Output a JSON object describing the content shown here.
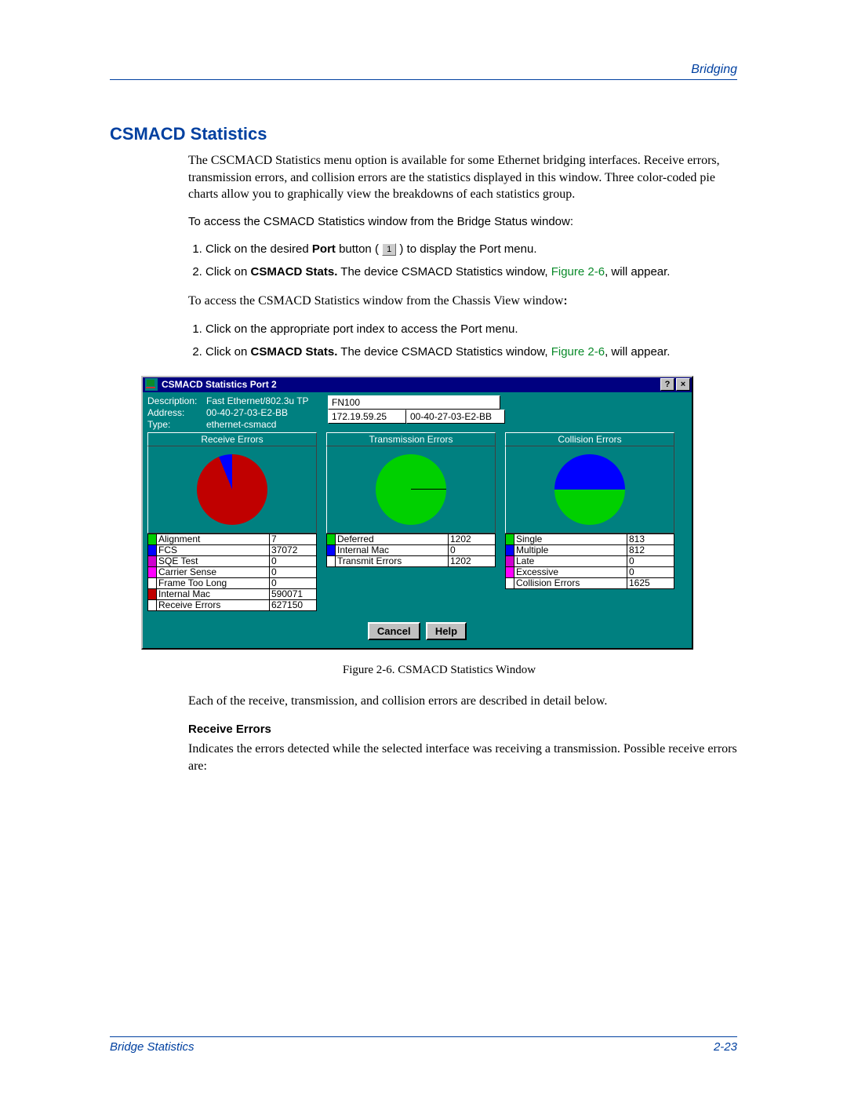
{
  "header": {
    "right": "Bridging"
  },
  "section_title": "CSMACD Statistics",
  "intro": "The CSCMACD Statistics menu option is available for some Ethernet bridging interfaces. Receive errors, transmission errors, and collision errors are the statistics displayed in this window. Three color-coded pie charts allow you to graphically view the breakdowns of each statistics group.",
  "access_bridge": "To access the CSMACD Statistics window from the Bridge Status window:",
  "step1a_pre": "Click on the desired ",
  "step1a_bold": "Port",
  "step1a_mid": " button ( ",
  "step1a_btn": "1",
  "step1a_post": " ) to display the Port menu.",
  "step2_pre": "Click on ",
  "step2_bold": "CSMACD Stats.",
  "step2_mid": " The device CSMACD Statistics window, ",
  "step2_link": "Figure 2-6",
  "step2_post": ", will appear.",
  "access_chassis_pre": "To access the CSMACD Statistics window from the Chassis View window",
  "access_chassis_bold": ":",
  "step1b": "Click on the appropriate port index to access the Port menu.",
  "window": {
    "title": "CSMACD Statistics Port 2",
    "help_btn": "?",
    "close_btn": "×",
    "device": "FN100",
    "ip": "172.19.59.25",
    "mac": "00-40-27-03-E2-BB",
    "desc_label": "Description:",
    "desc_value": "Fast Ethernet/802.3u TP",
    "addr_label": "Address:",
    "addr_value": "00-40-27-03-E2-BB",
    "type_label": "Type:",
    "type_value": "ethernet-csmacd",
    "groups": {
      "receive": {
        "title": "Receive Errors",
        "rows": [
          {
            "sw": "#00d000",
            "label": "Alignment",
            "value": "7"
          },
          {
            "sw": "#0000ff",
            "label": "FCS",
            "value": "37072"
          },
          {
            "sw": "#d000d0",
            "label": "SQE Test",
            "value": "0"
          },
          {
            "sw": "#ff00ff",
            "label": "Carrier Sense",
            "value": "0"
          },
          {
            "sw": "#ffffff",
            "label": "Frame Too Long",
            "value": "0"
          },
          {
            "sw": "#c00000",
            "label": "Internal Mac",
            "value": "590071"
          },
          {
            "sw": "#ffffff",
            "label": "Receive Errors",
            "value": "627150"
          }
        ]
      },
      "transmission": {
        "title": "Transmission Errors",
        "rows": [
          {
            "sw": "#00d000",
            "label": "Deferred",
            "value": "1202"
          },
          {
            "sw": "#0000ff",
            "label": "Internal Mac",
            "value": "0"
          },
          {
            "sw": "#ffffff",
            "label": "Transmit Errors",
            "value": "1202"
          }
        ]
      },
      "collision": {
        "title": "Collision Errors",
        "rows": [
          {
            "sw": "#00d000",
            "label": "Single",
            "value": "813"
          },
          {
            "sw": "#0000ff",
            "label": "Multiple",
            "value": "812"
          },
          {
            "sw": "#d000d0",
            "label": "Late",
            "value": "0"
          },
          {
            "sw": "#ff00ff",
            "label": "Excessive",
            "value": "0"
          },
          {
            "sw": "#ffffff",
            "label": "Collision Errors",
            "value": "1625"
          }
        ]
      }
    },
    "cancel": "Cancel",
    "help": "Help"
  },
  "caption": "Figure 2-6. CSMACD Statistics Window",
  "after_figure": "Each of the receive, transmission, and collision errors are described in detail below.",
  "receive_head": "Receive Errors",
  "receive_body": "Indicates the errors detected while the selected interface was receiving a transmission. Possible receive errors are:",
  "footer": {
    "left": "Bridge Statistics",
    "right": "2-23"
  },
  "chart_data": [
    {
      "type": "pie",
      "title": "Receive Errors",
      "categories": [
        "Alignment",
        "FCS",
        "SQE Test",
        "Carrier Sense",
        "Frame Too Long",
        "Internal Mac"
      ],
      "values": [
        7,
        37072,
        0,
        0,
        0,
        590071
      ],
      "total_label": "Receive Errors",
      "total": 627150,
      "colors": [
        "#00d000",
        "#0000ff",
        "#d000d0",
        "#ff00ff",
        "#ffffff",
        "#c00000"
      ]
    },
    {
      "type": "pie",
      "title": "Transmission Errors",
      "categories": [
        "Deferred",
        "Internal Mac"
      ],
      "values": [
        1202,
        0
      ],
      "total_label": "Transmit Errors",
      "total": 1202,
      "colors": [
        "#00d000",
        "#0000ff"
      ]
    },
    {
      "type": "pie",
      "title": "Collision Errors",
      "categories": [
        "Single",
        "Multiple",
        "Late",
        "Excessive"
      ],
      "values": [
        813,
        812,
        0,
        0
      ],
      "total_label": "Collision Errors",
      "total": 1625,
      "colors": [
        "#00d000",
        "#0000ff",
        "#d000d0",
        "#ff00ff"
      ]
    }
  ]
}
